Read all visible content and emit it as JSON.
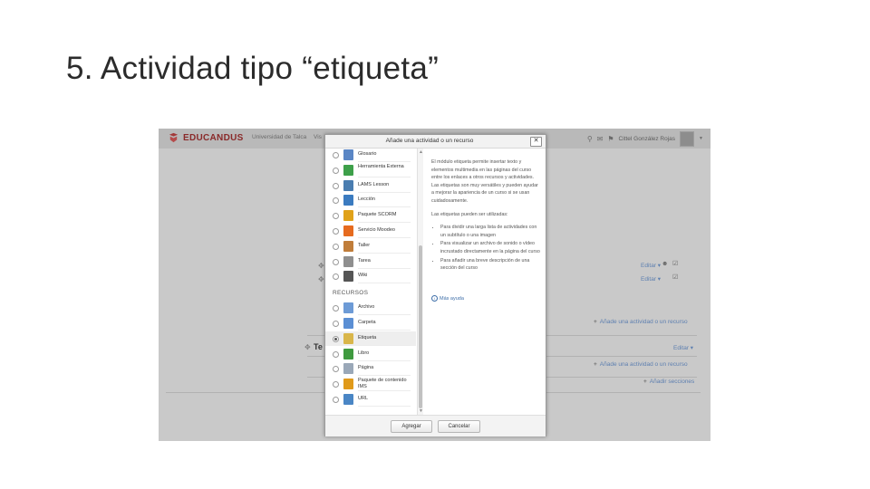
{
  "slide": {
    "title": "5. Actividad tipo “etiqueta”"
  },
  "app": {
    "brand": "EDUCANDUS",
    "nav": [
      "Universidad de Talca",
      "Vis"
    ],
    "user_name": "Cittel González Rojas",
    "icons": [
      "search-icon",
      "chat-icon",
      "bookmark-icon"
    ]
  },
  "course": {
    "edit_links": [
      "Editar ▾",
      "Editar ▾"
    ],
    "add_activity": "Añade una actividad o un recurso",
    "section_title": "Te",
    "section_edit": "Editar ▾",
    "add_section": "Añadir secciones"
  },
  "modal": {
    "title": "Añade una actividad o un recurso",
    "close": "✕",
    "activities": [
      {
        "label": "Glosario",
        "icon": "glossary-icon",
        "color": "#5a86c5"
      },
      {
        "label": "Herramienta Externa",
        "icon": "puzzle-icon",
        "color": "#3ea04a"
      },
      {
        "label": "LAMS Lesson",
        "icon": "lams-icon",
        "color": "#4a7db0"
      },
      {
        "label": "Lección",
        "icon": "lesson-icon",
        "color": "#3b7bc0"
      },
      {
        "label": "Paquete SCORM",
        "icon": "scorm-icon",
        "color": "#e0a21a"
      },
      {
        "label": "Servicio Moodeo",
        "icon": "moodeo-icon",
        "color": "#e66b1f"
      },
      {
        "label": "Taller",
        "icon": "workshop-icon",
        "color": "#c07d3a"
      },
      {
        "label": "Tarea",
        "icon": "assignment-icon",
        "color": "#8f8f8f"
      },
      {
        "label": "Wiki",
        "icon": "wiki-icon",
        "color": "#555555"
      }
    ],
    "resources_heading": "RECURSOS",
    "resources": [
      {
        "label": "Archivo",
        "icon": "file-icon",
        "color": "#6d9bd6",
        "selected": false
      },
      {
        "label": "Carpeta",
        "icon": "folder-icon",
        "color": "#5b8fd4",
        "selected": false
      },
      {
        "label": "Etiqueta",
        "icon": "label-tag-icon",
        "color": "#d9b64a",
        "selected": true
      },
      {
        "label": "Libro",
        "icon": "book-icon",
        "color": "#3f9a3f",
        "selected": false
      },
      {
        "label": "Página",
        "icon": "page-icon",
        "color": "#9aa8b8",
        "selected": false
      },
      {
        "label": "Paquete de contenido IMS",
        "icon": "ims-icon",
        "color": "#e09a1a",
        "selected": false
      },
      {
        "label": "URL",
        "icon": "url-icon",
        "color": "#4a86c5",
        "selected": false
      }
    ],
    "description": {
      "intro": "El módulo etiqueta permite insertar texto y elementos multimedia en las páginas del curso entre los enlaces a otros recursos y actividades. Las etiquetas son muy versátiles y pueden ayudar a mejorar la apariencia de un curso si se usan cuidadosamente.",
      "uses_title": "Las etiquetas pueden ser utilizadas:",
      "uses": [
        "Para dividir una larga lista de actividades con un subtítulo o una imagen",
        "Para visualizar un archivo de sonido o vídeo incrustado directamente en la página del curso",
        "Para añadir una breve descripción de una sección del curso"
      ]
    },
    "more_help": "Más ayuda",
    "buttons": {
      "add": "Agregar",
      "cancel": "Cancelar"
    }
  }
}
